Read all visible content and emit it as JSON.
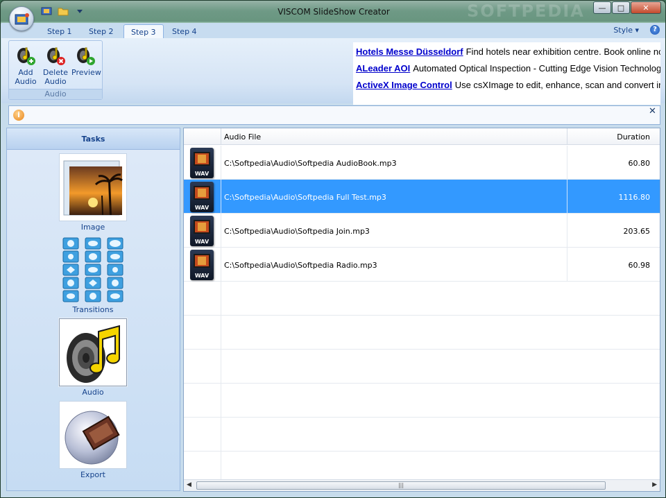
{
  "window": {
    "title": "VISCOM SlideShow Creator"
  },
  "ribbon": {
    "tabs": [
      {
        "label": "Step 1"
      },
      {
        "label": "Step 2"
      },
      {
        "label": "Step 3"
      },
      {
        "label": "Step 4"
      }
    ],
    "active_tab": "Step 3",
    "style_label": "Style",
    "groups": {
      "audio": {
        "label": "Audio",
        "buttons": {
          "add": "Add\nAudio",
          "delete": "Delete\nAudio",
          "preview": "Preview"
        }
      }
    }
  },
  "ads": [
    {
      "link": "Hotels Messe Düsseldorf",
      "text": "Find hotels near exhibition centre. Book online now"
    },
    {
      "link": "ALeader AOI",
      "text": "Automated Optical Inspection - Cutting Edge Vision Technology"
    },
    {
      "link": "ActiveX Image Control",
      "text": "Use csXImage to edit, enhance, scan and convert images"
    }
  ],
  "tasks": {
    "header": "Tasks",
    "items": [
      {
        "label": "Image"
      },
      {
        "label": "Transitions"
      },
      {
        "label": "Audio"
      },
      {
        "label": "Export"
      }
    ],
    "selected": "Audio"
  },
  "audio_list": {
    "columns": {
      "file": "Audio File",
      "duration": "Duration"
    },
    "icon_text": "WAV",
    "rows": [
      {
        "file": "C:\\Softpedia\\Audio\\Softpedia AudioBook.mp3",
        "duration": "60.80",
        "selected": false
      },
      {
        "file": "C:\\Softpedia\\Audio\\Softpedia Full Test.mp3",
        "duration": "1116.80",
        "selected": true
      },
      {
        "file": "C:\\Softpedia\\Audio\\Softpedia Join.mp3",
        "duration": "203.65",
        "selected": false
      },
      {
        "file": "C:\\Softpedia\\Audio\\Softpedia Radio.mp3",
        "duration": "60.98",
        "selected": false
      }
    ]
  },
  "watermark": "SOFTPEDIA",
  "colors": {
    "selection": "#3399ff",
    "ribbon_text": "#15428b",
    "link": "#0000cc"
  }
}
